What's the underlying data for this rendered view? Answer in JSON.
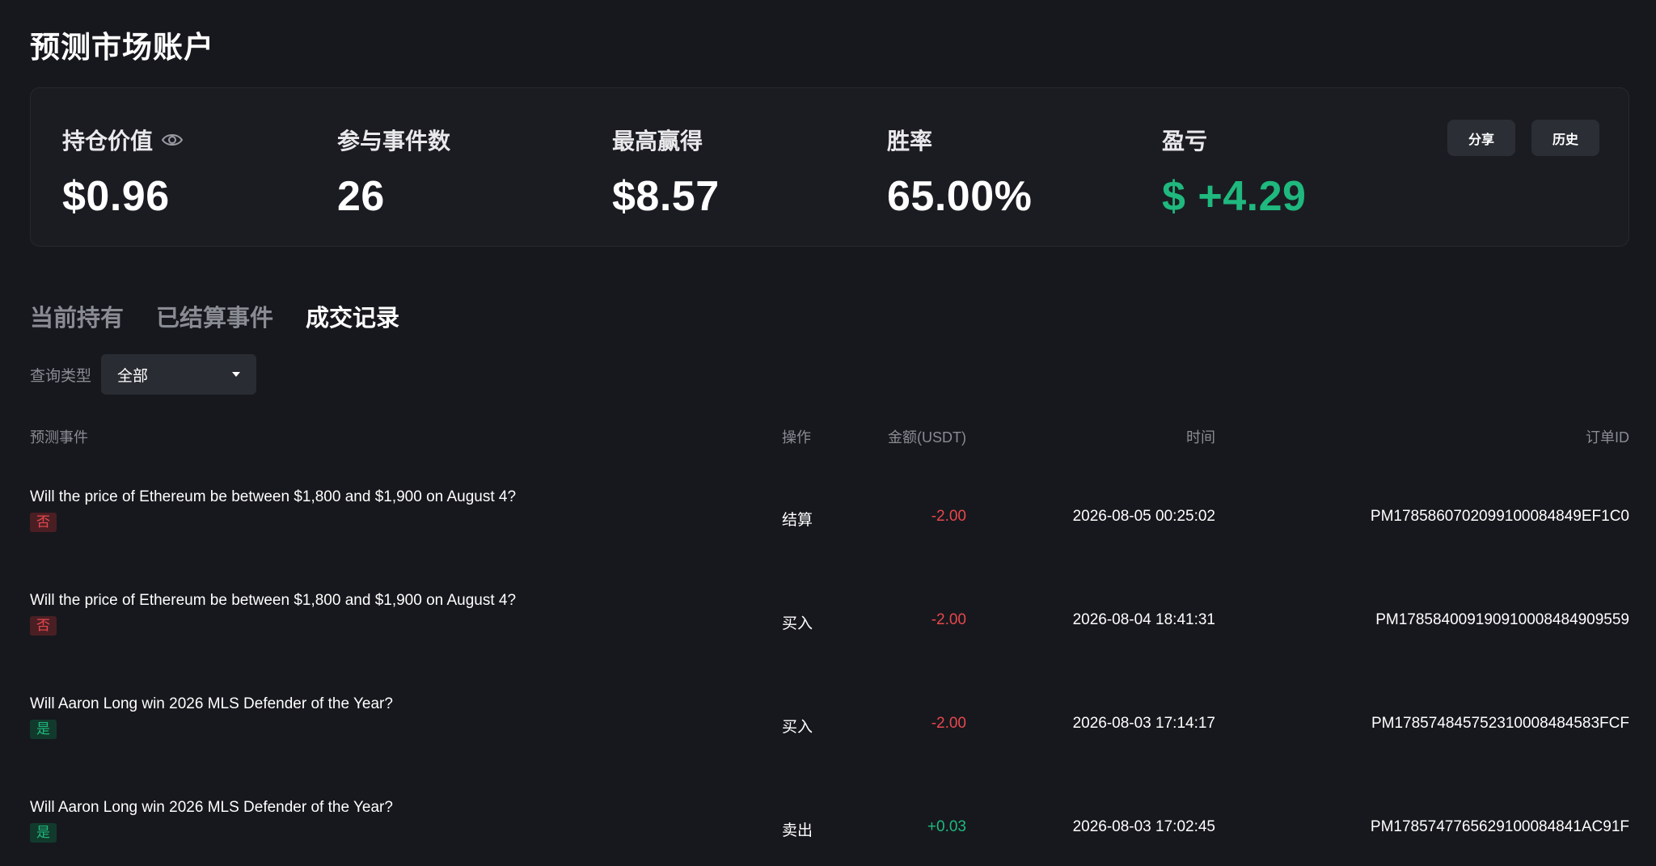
{
  "page": {
    "title": "预测市场账户"
  },
  "summary": {
    "holding_value": {
      "label": "持仓价值",
      "value": "$0.96"
    },
    "events_joined": {
      "label": "参与事件数",
      "value": "26"
    },
    "max_win": {
      "label": "最高赢得",
      "value": "$8.57"
    },
    "win_rate": {
      "label": "胜率",
      "value": "65.00%"
    },
    "pnl": {
      "label": "盈亏",
      "value": "$ +4.29"
    },
    "share_label": "分享",
    "history_label": "历史"
  },
  "tabs": [
    {
      "label": "当前持有",
      "active": false
    },
    {
      "label": "已结算事件",
      "active": false
    },
    {
      "label": "成交记录",
      "active": true
    }
  ],
  "filter": {
    "label": "查询类型",
    "value": "全部"
  },
  "table": {
    "columns": {
      "event": "预测事件",
      "action": "操作",
      "amount": "金额(USDT)",
      "time": "时间",
      "order_id": "订单ID"
    },
    "rows": [
      {
        "event": "Will the price of Ethereum be between $1,800 and $1,900 on August 4?",
        "outcome": "否",
        "action": "结算",
        "amount": "-2.00",
        "time": "2026-08-05 00:25:02",
        "order_id": "PM178586070209910008484​9EF1C0"
      },
      {
        "event": "Will the price of Ethereum be between $1,800 and $1,900 on August 4?",
        "outcome": "否",
        "action": "买入",
        "amount": "-2.00",
        "time": "2026-08-04 18:41:31",
        "order_id": "PM178584009190910008484909559"
      },
      {
        "event": "Will Aaron Long win 2026 MLS Defender of the Year?",
        "outcome": "是",
        "action": "买入",
        "amount": "-2.00",
        "time": "2026-08-03 17:14:17",
        "order_id": "PM17857484575231000848458​3FCF"
      },
      {
        "event": "Will Aaron Long win 2026 MLS Defender of the Year?",
        "outcome": "是",
        "action": "卖出",
        "amount": "+0.03",
        "time": "2026-08-03 17:02:45",
        "order_id": "PM178574776562910008484​1AC91F"
      }
    ]
  },
  "colors": {
    "background": "#17181d",
    "positive": "#1fb87e",
    "negative": "#e5484d",
    "muted": "#8a8c94"
  }
}
